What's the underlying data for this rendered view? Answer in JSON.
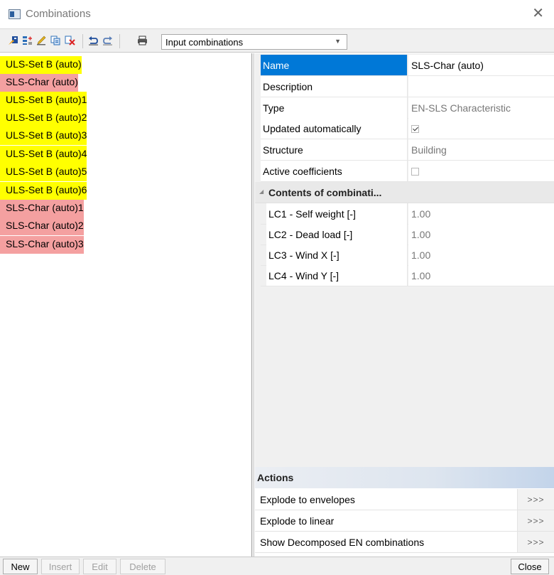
{
  "window": {
    "title": "Combinations",
    "close_icon": "close-icon"
  },
  "toolbar": {
    "icons": [
      "new-combination-icon",
      "insert-icon",
      "edit-icon",
      "copy-icon",
      "delete-icon",
      "undo-icon",
      "redo-icon",
      "print-icon"
    ],
    "dropdown_value": "Input combinations"
  },
  "combinations": [
    {
      "label": "ULS-Set B (auto)",
      "kind": "uls"
    },
    {
      "label": "SLS-Char (auto)",
      "kind": "sls"
    },
    {
      "label": "ULS-Set B (auto)1",
      "kind": "uls"
    },
    {
      "label": "ULS-Set B (auto)2",
      "kind": "uls"
    },
    {
      "label": "ULS-Set B (auto)3",
      "kind": "uls"
    },
    {
      "label": "ULS-Set B (auto)4",
      "kind": "uls"
    },
    {
      "label": "ULS-Set B (auto)5",
      "kind": "uls"
    },
    {
      "label": "ULS-Set B (auto)6",
      "kind": "uls"
    },
    {
      "label": "SLS-Char (auto)1",
      "kind": "sls"
    },
    {
      "label": "SLS-Char (auto)2",
      "kind": "sls"
    },
    {
      "label": "SLS-Char (auto)3",
      "kind": "sls"
    }
  ],
  "colors": {
    "uls": "#ffff00",
    "sls": "#f4a0a0",
    "selection": "#0078d7"
  },
  "properties": {
    "name": {
      "label": "Name",
      "value": "SLS-Char (auto)"
    },
    "description": {
      "label": "Description",
      "value": ""
    },
    "type": {
      "label": "Type",
      "value": "EN-SLS Characteristic"
    },
    "updated": {
      "label": "Updated automatically",
      "checked": true
    },
    "structure": {
      "label": "Structure",
      "value": "Building"
    },
    "active_coefficients": {
      "label": "Active coefficients",
      "checked": false
    },
    "contents_header": "Contents of combinati...",
    "contents": [
      {
        "label": "LC1 - Self weight [-]",
        "value": "1.00"
      },
      {
        "label": "LC2 - Dead load [-]",
        "value": "1.00"
      },
      {
        "label": "LC3 - Wind X [-]",
        "value": "1.00"
      },
      {
        "label": "LC4 - Wind Y [-]",
        "value": "1.00"
      }
    ]
  },
  "actions": {
    "header": "Actions",
    "items": [
      {
        "label": "Explode to envelopes",
        "button": ">>>"
      },
      {
        "label": "Explode to linear",
        "button": ">>>"
      },
      {
        "label": "Show Decomposed EN combinations",
        "button": ">>>"
      }
    ]
  },
  "buttons": {
    "new": "New",
    "insert": "Insert",
    "edit": "Edit",
    "delete": "Delete",
    "close": "Close"
  }
}
